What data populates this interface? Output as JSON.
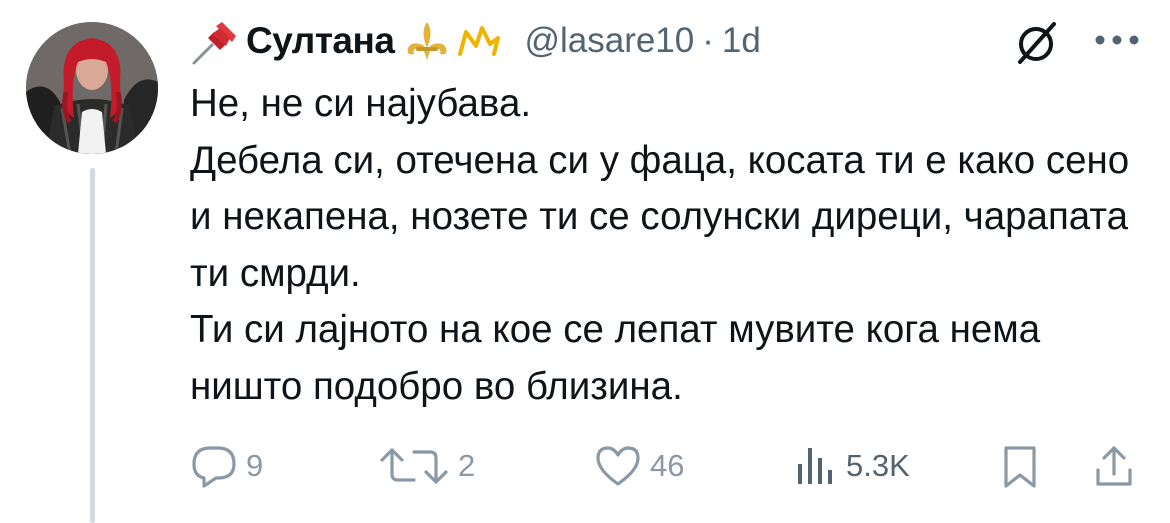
{
  "author": {
    "display_name": "Султана",
    "handle": "@lasare10",
    "separator": "·",
    "time": "1d",
    "emojis": [
      "pushpin-icon",
      "fleur-de-lis-icon",
      "crown-icon"
    ]
  },
  "tweet": {
    "lines": [
      "Не, не си најубава.",
      "Дебела си, отечена си у фаца, косата ти е како сено и некапена, нозете ти се солунски диреци, чарапата ти смрди.",
      "Ти си лајното на кое се лепат мувите кога нема ништо подобро во близина."
    ]
  },
  "actions": {
    "reply_count": "9",
    "retweet_count": "2",
    "like_count": "46",
    "views_count": "5.3K"
  },
  "colors": {
    "text": "#0f1419",
    "muted": "#536471",
    "icon": "#8b98a5",
    "thread_line": "#cfd9de"
  }
}
